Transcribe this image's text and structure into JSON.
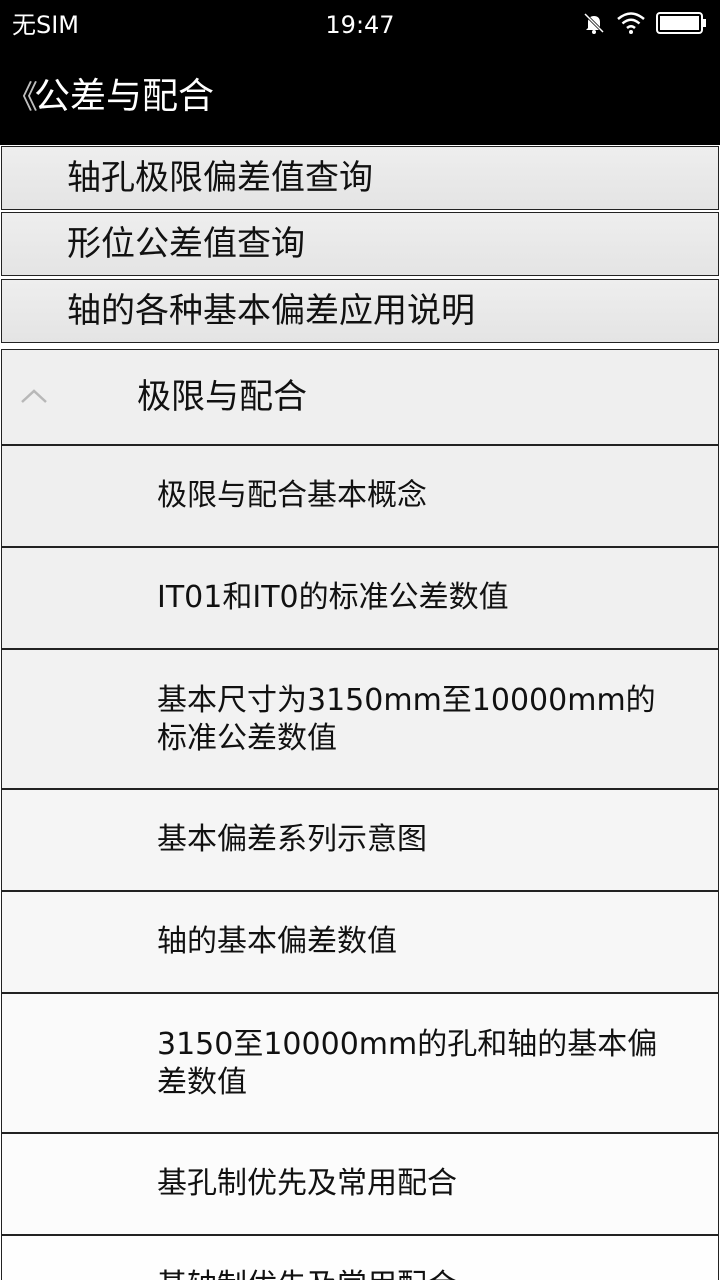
{
  "status_bar": {
    "carrier": "无SIM",
    "time": "19:47",
    "icons": [
      "mute-bell-icon",
      "wifi-icon",
      "battery-icon"
    ]
  },
  "nav": {
    "back_glyph": "《",
    "title": "公差与配合"
  },
  "top_items": [
    {
      "label": "轴孔极限偏差值查询"
    },
    {
      "label": "形位公差值查询"
    },
    {
      "label": "轴的各种基本偏差应用说明"
    }
  ],
  "group": {
    "label": "极限与配合",
    "expanded": true,
    "items": [
      {
        "label": "极限与配合基本概念"
      },
      {
        "label": "IT01和IT0的标准公差数值"
      },
      {
        "label": "基本尺寸为3150mm至10000mm的标准公差数值"
      },
      {
        "label": "基本偏差系列示意图"
      },
      {
        "label": "轴的基本偏差数值"
      },
      {
        "label": "3150至10000mm的孔和轴的基本偏差数值"
      },
      {
        "label": "基孔制优先及常用配合"
      },
      {
        "label": "基轴制优先及常用配合"
      }
    ]
  }
}
